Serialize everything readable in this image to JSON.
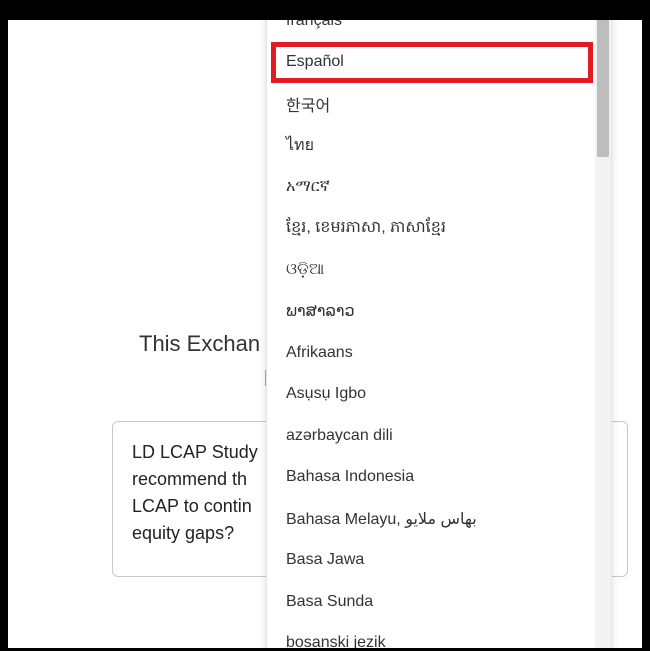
{
  "background": {
    "heading": "This Exchan",
    "question_lines": [
      "LD LCAP Study",
      "recommend th",
      "LCAP to contin",
      "equity gaps?"
    ]
  },
  "language_dropdown": {
    "selected_index": 1,
    "highlight_color": "#e31b23",
    "options": [
      "français",
      "Español",
      "한국어",
      "ไทย",
      "አማርኛ",
      "ខ្មែរ, ខេមរភាសា, ភាសាខ្មែរ",
      "ଓଡ଼ିଆ",
      "ພາສາລາວ",
      "Afrikaans",
      "Asụsụ Igbo",
      "azərbaycan dili",
      "Bahasa Indonesia",
      "Bahasa Melayu, بهاس ملايو",
      "Basa Jawa",
      "Basa Sunda",
      "bosanski jezik"
    ]
  }
}
